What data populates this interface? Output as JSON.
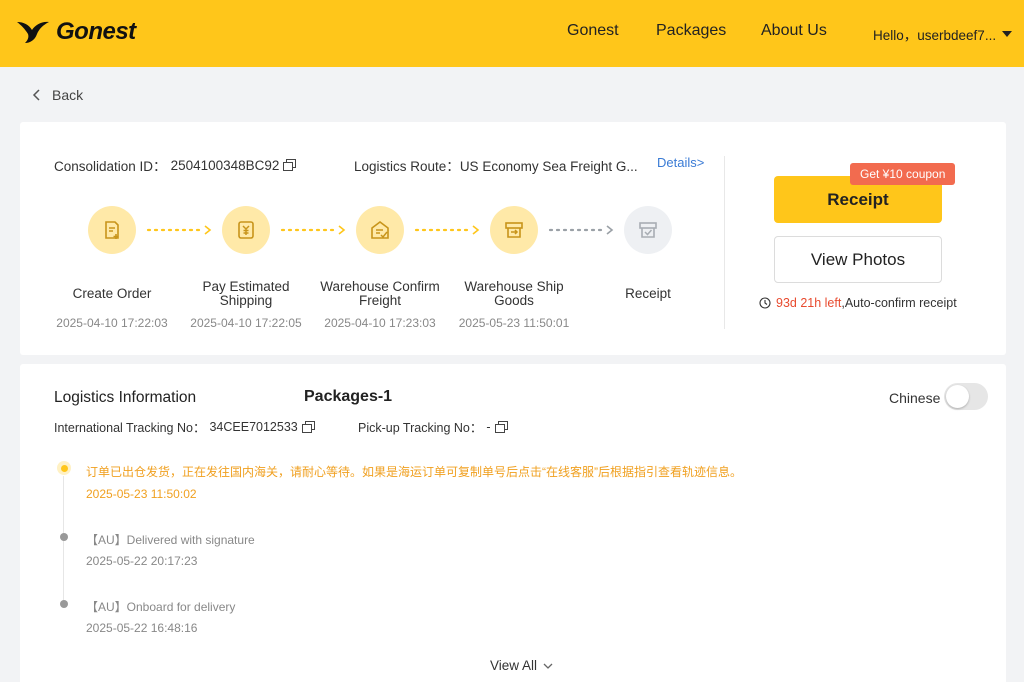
{
  "header": {
    "logo_text": "Gonest",
    "nav": [
      "Gonest",
      "Packages",
      "About Us"
    ],
    "user_greeting": "Hello，userbdeef7..."
  },
  "back_label": "Back",
  "order": {
    "consolidation_label": "Consolidation ID：",
    "consolidation_id": "2504100348BC92",
    "route_label": "Logistics Route：",
    "route_value": "US Economy Sea Freight G...",
    "details_link": "Details>",
    "steps": [
      {
        "label": "Create Order",
        "time": "2025-04-10 17:22:03",
        "icon": "create-order-icon",
        "done": true
      },
      {
        "label": "Pay Estimated Shipping",
        "time": "2025-04-10 17:22:05",
        "icon": "payment-icon",
        "done": true
      },
      {
        "label": "Warehouse Confirm Freight",
        "time": "2025-04-10 17:23:03",
        "icon": "warehouse-icon",
        "done": true
      },
      {
        "label": "Warehouse Ship Goods",
        "time": "2025-05-23 11:50:01",
        "icon": "ship-goods-icon",
        "done": true
      },
      {
        "label": "Receipt",
        "time": "",
        "icon": "receipt-icon",
        "done": false
      }
    ],
    "receipt_button": "Receipt",
    "coupon_badge": "Get ¥10 coupon",
    "photos_button": "View Photos",
    "countdown_time": "93d 21h left",
    "countdown_text": ",Auto-confirm receipt"
  },
  "logistics": {
    "title": "Logistics Information",
    "package_title": "Packages-1",
    "language_toggle_label": "Chinese",
    "language_toggle_on": false,
    "intl_label": "International Tracking No：",
    "intl_value": "34CEE7012533",
    "pickup_label": "Pick-up Tracking No：",
    "pickup_value": "-",
    "events": [
      {
        "text": "订单已出仓发货，正在发往国内海关，请耐心等待。如果是海运订单可复制单号后点击“在线客服”后根据指引查看轨迹信息。",
        "time": "2025-05-23 11:50:02",
        "active": true
      },
      {
        "text": "【AU】Delivered with signature",
        "time": "2025-05-22 20:17:23",
        "active": false
      },
      {
        "text": "【AU】Onboard for delivery",
        "time": "2025-05-22 16:48:16",
        "active": false
      }
    ],
    "view_all": "View All"
  },
  "colors": {
    "brand_yellow": "#ffc61a",
    "step_circle": "#ffe9a8",
    "coupon_red": "#f26b4f",
    "countdown_red": "#e84b2f",
    "link_blue": "#3a7bd5",
    "timeline_orange": "#f0a020"
  }
}
